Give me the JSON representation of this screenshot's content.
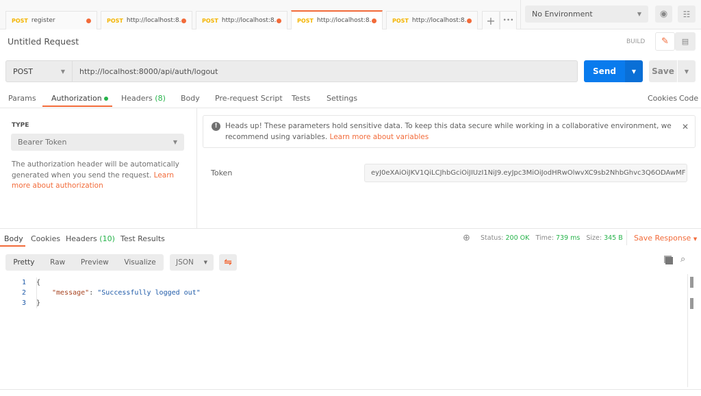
{
  "tabs": [
    {
      "method": "POST",
      "label": "register",
      "active": false
    },
    {
      "method": "POST",
      "label": "http://localhost:8...",
      "active": false
    },
    {
      "method": "POST",
      "label": "http://localhost:8...",
      "active": false
    },
    {
      "method": "POST",
      "label": "http://localhost:8...",
      "active": true
    },
    {
      "method": "POST",
      "label": "http://localhost:8...",
      "active": false
    }
  ],
  "environment": "No Environment",
  "request_title": "Untitled Request",
  "build_label": "BUILD",
  "method": "POST",
  "url": "http://localhost:8000/api/auth/logout",
  "send_label": "Send",
  "save_label": "Save",
  "request_tabs": {
    "params": "Params",
    "authorization": "Authorization",
    "headers": "Headers",
    "headers_count": "(8)",
    "body": "Body",
    "prerequest": "Pre-request Script",
    "tests": "Tests",
    "settings": "Settings"
  },
  "cookies_link": "Cookies",
  "code_link": "Code",
  "auth": {
    "type_label": "TYPE",
    "type_value": "Bearer Token",
    "description": "The authorization header will be automatically generated when you send the request.",
    "learn_more": "Learn more about authorization",
    "alert": "Heads up! These parameters hold sensitive data. To keep this data secure while working in a collaborative environment, we recommend using variables.",
    "alert_link": "Learn more about variables",
    "token_label": "Token",
    "token_value": "eyJ0eXAiOiJKV1QiLCJhbGciOiJIUzI1NiJ9.eyJpc3MiOiJodHRwOlwvXC9sb2NhbGhvc3Q6ODAwMF ..."
  },
  "response": {
    "tabs": {
      "body": "Body",
      "cookies": "Cookies",
      "headers": "Headers",
      "headers_count": "(10)",
      "tests": "Test Results"
    },
    "status_label": "Status:",
    "status": "200 OK",
    "time_label": "Time:",
    "time": "739 ms",
    "size_label": "Size:",
    "size": "345 B",
    "save_response": "Save Response",
    "views": [
      "Pretty",
      "Raw",
      "Preview",
      "Visualize"
    ],
    "format": "JSON",
    "lines": [
      {
        "n": "1",
        "text": "{"
      },
      {
        "n": "2",
        "key": "\"message\"",
        "value": "\"Successfully logged out\""
      },
      {
        "n": "3",
        "text": "}"
      }
    ]
  },
  "colors": {
    "accent": "#f26b3a",
    "send": "#097bed",
    "success": "#26b34a"
  }
}
